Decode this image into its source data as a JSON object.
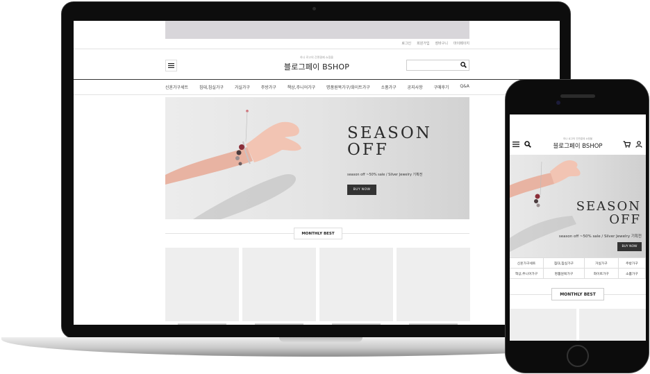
{
  "desktop": {
    "util_links": [
      "로그인",
      "회원가입",
      "장바구니",
      "마이페이지"
    ],
    "logo_sub": "하나 로고의 간편결제 쇼핑몰",
    "logo": "블로그페이 BSHOP",
    "nav": [
      "신혼가구세트",
      "침대,침실가구",
      "거실가구",
      "주방가구",
      "책상,주니어가구",
      "명품원목가구/화이트가구",
      "소품가구",
      "공지사항",
      "구매후기",
      "Q&A"
    ],
    "hero": {
      "title_line1": "SEASON",
      "title_line2": "OFF",
      "subtitle": "season off ~50% sale / Silver Jewelry 기획전",
      "button": "BUY NOW"
    },
    "section_title": "MONTHLY BEST"
  },
  "mobile": {
    "logo_sub": "하나 로고의 간편결제 쇼핑몰",
    "logo": "블로그페이 BSHOP",
    "hero": {
      "title_line1": "SEASON",
      "title_line2": "OFF",
      "subtitle": "season off ~50% sale / Silver Jewelry 기획전",
      "button": "BUY NOW"
    },
    "categories": [
      "신혼가구세트",
      "침대,침실가구",
      "거실가구",
      "주방가구",
      "책상,주니어가구",
      "명품원목가구",
      "화이트가구",
      "소품가구"
    ],
    "section_title": "MONTHLY BEST"
  },
  "icons": {
    "menu": "hamburger-menu-icon",
    "search": "search-icon",
    "cart": "cart-icon",
    "user": "user-icon"
  },
  "colors": {
    "dark_button": "#333333",
    "banner": "#d8d6da",
    "placeholder": "#eeeeee"
  }
}
